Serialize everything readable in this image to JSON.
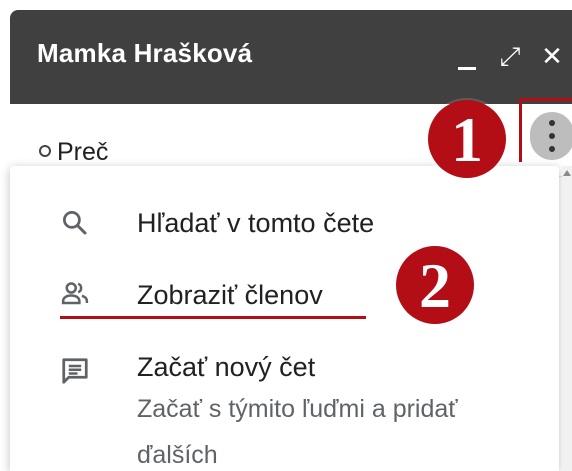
{
  "window": {
    "title": "Mamka Hrašková",
    "minimize_icon": "minimize-icon",
    "popout_icon": "popout-icon",
    "popout_glyph": "⤢",
    "close_icon": "close-icon",
    "close_glyph": "✕"
  },
  "status": {
    "label": "Preč",
    "more_icon": "more-vert-icon"
  },
  "menu": {
    "items": [
      {
        "label": "Hľadať v tomto čete",
        "icon": "search-icon"
      },
      {
        "label": "Zobraziť členov",
        "icon": "people-icon"
      },
      {
        "label": "Začať nový čet",
        "sublabel": "Začať s týmito ľuďmi a pridať ďalších",
        "icon": "chat-icon"
      }
    ]
  },
  "annotations": {
    "step1": "1",
    "step2": "2",
    "accent_color": "#b30d16"
  },
  "colors": {
    "header_bg": "#404040",
    "icon_gray": "#5f6368"
  }
}
